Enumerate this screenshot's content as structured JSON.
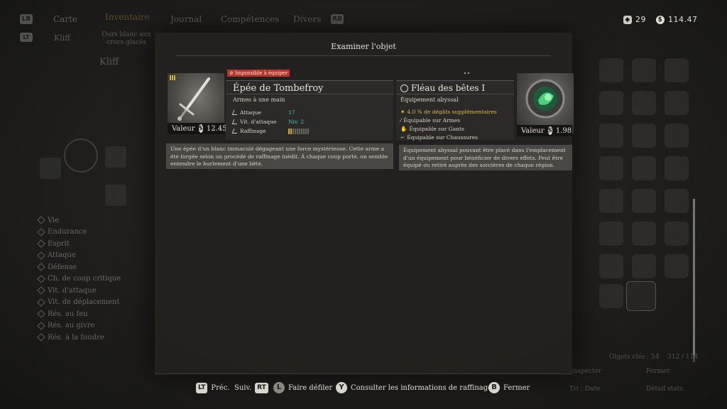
{
  "nav": {
    "lb": "LB",
    "rb": "RB",
    "lt": "LT",
    "tabs": [
      "Carte",
      "Inventaire",
      "Journal",
      "Compétences",
      "Divers"
    ],
    "badge_count": "0",
    "sub_kliff": "Kliff",
    "sub_item": "Ours blanc aux crocs glacés",
    "character": "Kliff"
  },
  "currency": {
    "gems": "29",
    "coins": "114.47"
  },
  "stats": [
    "Vie",
    "Endurance",
    "Esprit",
    "Attaque",
    "Défense",
    "Ch. de coup critique",
    "Vit. d'attaque",
    "Vit. de déplacement",
    "Rés. au feu",
    "Rés. au givre",
    "Rés. à la foudre"
  ],
  "modal": {
    "title": "Examiner l'objet",
    "left": {
      "badge": "Impossible à équiper",
      "value_label": "Valeur",
      "value": "12.45",
      "name": "Épée de Tombefroy",
      "subtype": "Armes à une main",
      "stats": [
        {
          "label": "Attaque",
          "value": "17"
        },
        {
          "label": "Vit. d'attaque",
          "value": "Niv. 2"
        },
        {
          "label": "Raffinage"
        }
      ],
      "refine_level": 2,
      "refine_max": 10,
      "description": "Une épée d'un blanc immaculé dégageant une force mystérieuse. Cette arme a été forgée selon un procédé de raffinage inédit. À chaque coup porté, on semble entendre le hurlement d'une bête."
    },
    "right": {
      "name": "Fléau des bêtes I",
      "subtype": "Équipement abyssal",
      "effect": "4.0 % de dégâts supplémentaires",
      "slots": [
        "Équipable sur Armes",
        "Équipable sur Gants",
        "Équipable sur Chaussures"
      ],
      "value_label": "Valeur",
      "value": "1.98",
      "description": "Équipement abyssal pouvant être placé dans l'emplacement d'un équipement pour bénéficier de divers effets. Peut être équipé ou retiré auprès des sorcières de chaque région."
    }
  },
  "background_footer": {
    "keys": "Objets clés : 54",
    "capacity": "312 / 114",
    "inspect": "Inspecter",
    "close": "Fermer",
    "sort": "Tri : Date",
    "detail": "Détail stats."
  },
  "footer": {
    "lt": "LT",
    "prev": "Préc.",
    "next": "Suiv.",
    "rt": "RT",
    "ls": "L",
    "scroll": "Faire défiler",
    "y": "Y",
    "refine_info": "Consulter les informations de raffinage",
    "b": "B",
    "close": "Fermer"
  },
  "colors": {
    "accent_gold": "#d6b039",
    "badge_red": "#b9342b",
    "teal": "#4fc9b8"
  }
}
